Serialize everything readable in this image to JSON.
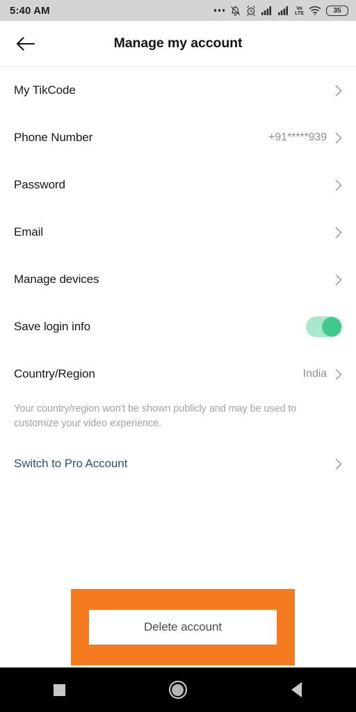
{
  "status_bar": {
    "time": "5:40 AM",
    "icons": [
      "more-dots-icon",
      "bell-muted-icon",
      "alarm-clock-icon",
      "signal-bars-icon",
      "signal-bars-icon",
      "volte-icon",
      "wifi-icon"
    ],
    "volte_top": "Vo",
    "volte_bottom": "LTE",
    "battery_level": "35"
  },
  "app_bar": {
    "title": "Manage my account",
    "back_icon": "arrow-left-icon"
  },
  "list": {
    "items": [
      {
        "label": "My TikCode",
        "value": "",
        "type": "chevron"
      },
      {
        "label": "Phone Number",
        "value": "+91*****939",
        "type": "chevron"
      },
      {
        "label": "Password",
        "value": "",
        "type": "chevron"
      },
      {
        "label": "Email",
        "value": "",
        "type": "chevron"
      },
      {
        "label": "Manage devices",
        "value": "",
        "type": "chevron"
      },
      {
        "label": "Save login info",
        "value": "on",
        "type": "toggle"
      },
      {
        "label": "Country/Region",
        "value": "India",
        "type": "chevron"
      }
    ],
    "country_description": "Your country/region won't be shown publicly and may be used to customize your video experience.",
    "pro_account": {
      "label": "Switch to Pro Account",
      "color": "#2f5568"
    }
  },
  "delete": {
    "button_label": "Delete account",
    "highlight_color": "#f47b20"
  },
  "nav_bar": {
    "recents": "square-icon",
    "home": "circle-home-icon",
    "back": "triangle-back-icon"
  },
  "colors": {
    "toggle_track": "#a9e7cb",
    "toggle_knob": "#3fca8b",
    "accent_orange": "#f47b20"
  }
}
